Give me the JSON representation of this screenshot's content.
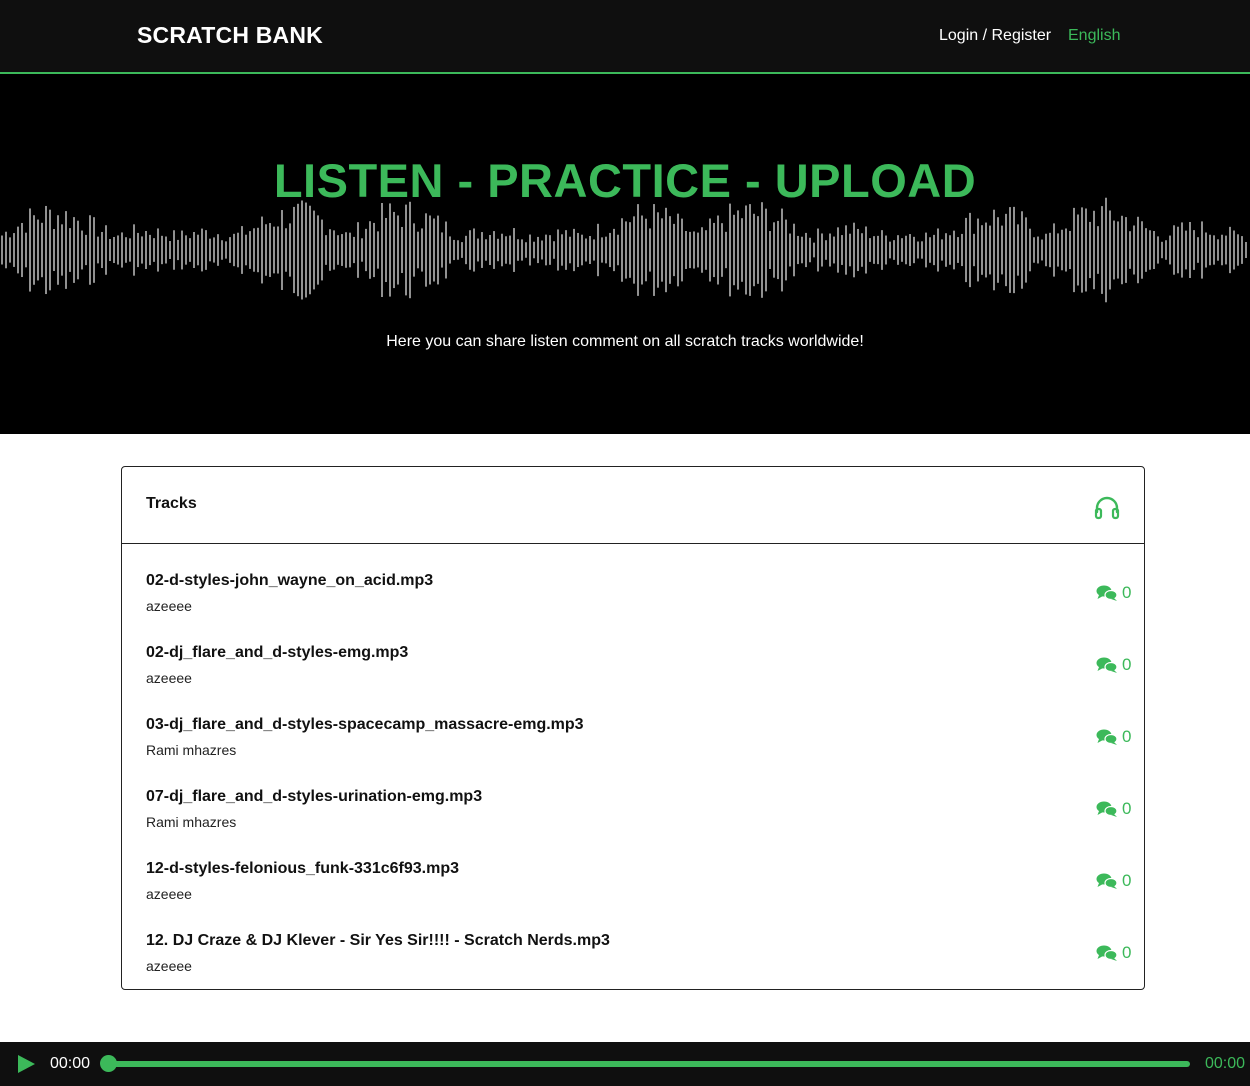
{
  "navbar": {
    "brand": "SCRATCH BANK",
    "login": "Login / Register",
    "language": "English"
  },
  "hero": {
    "title": "LISTEN - PRACTICE - UPLOAD",
    "subtitle": "Here you can share listen comment on all scratch tracks worldwide!"
  },
  "tracks": {
    "header": "Tracks",
    "header_icon": "headphones-icon",
    "items": [
      {
        "title": "02-d-styles-john_wayne_on_acid.mp3",
        "user": "azeeee",
        "comments": "0"
      },
      {
        "title": "02-dj_flare_and_d-styles-emg.mp3",
        "user": "azeeee",
        "comments": "0"
      },
      {
        "title": "03-dj_flare_and_d-styles-spacecamp_massacre-emg.mp3",
        "user": "Rami mhazres",
        "comments": "0"
      },
      {
        "title": "07-dj_flare_and_d-styles-urination-emg.mp3",
        "user": "Rami mhazres",
        "comments": "0"
      },
      {
        "title": "12-d-styles-felonious_funk-331c6f93.mp3",
        "user": "azeeee",
        "comments": "0"
      },
      {
        "title": "12. DJ Craze & DJ Klever - Sir Yes Sir!!!! - Scratch Nerds.mp3",
        "user": "azeeee",
        "comments": "0"
      }
    ]
  },
  "player": {
    "current_time": "00:00",
    "total_time": "00:00",
    "progress": 0
  },
  "colors": {
    "accent": "#3cb95a",
    "navbar_bg": "#0f0f0f",
    "hero_bg": "#000000"
  }
}
